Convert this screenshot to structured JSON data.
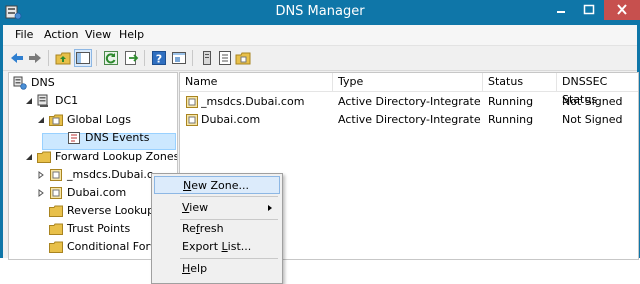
{
  "window": {
    "title": "DNS Manager"
  },
  "menubar": {
    "items": [
      "File",
      "Action",
      "View",
      "Help"
    ]
  },
  "toolbar": {
    "buttons": [
      "back-icon",
      "forward-icon",
      "up-folder-icon",
      "show-hide-tree-icon",
      "refresh-icon",
      "export-icon",
      "help-icon",
      "properties-icon",
      "server-icon",
      "list-icon",
      "zone-icon"
    ]
  },
  "tree": {
    "root": "DNS",
    "server": "DC1",
    "global_logs": "Global Logs",
    "dns_events": "DNS Events",
    "forward_zones": "Forward Lookup Zones",
    "msdcs": "_msdcs.Dubai.c",
    "dubai": "Dubai.com",
    "reverse_zones": "Reverse Lookup Zon",
    "trust_points": "Trust Points",
    "conditional": "Conditional Forwar"
  },
  "list": {
    "columns": [
      "Name",
      "Type",
      "Status",
      "DNSSEC Status"
    ],
    "rows": [
      {
        "name": "_msdcs.Dubai.com",
        "type": "Active Directory-Integrated Pr...",
        "status": "Running",
        "dnssec": "Not Signed"
      },
      {
        "name": "Dubai.com",
        "type": "Active Directory-Integrated Pr...",
        "status": "Running",
        "dnssec": "Not Signed"
      }
    ]
  },
  "context_menu": {
    "new_zone": {
      "prefix": "",
      "key": "N",
      "rest": "ew Zone..."
    },
    "view": {
      "prefix": "",
      "key": "V",
      "rest": "iew"
    },
    "refresh": {
      "prefix": "Re",
      "key": "f",
      "rest": "resh"
    },
    "export": {
      "prefix": "Export ",
      "key": "L",
      "rest": "ist..."
    },
    "help": {
      "prefix": "",
      "key": "H",
      "rest": "elp"
    }
  },
  "colors": {
    "titlebar": "#0f76a8",
    "close_button": "#c7504e",
    "selection": "#cce8ff",
    "menu_highlight": "#dcebfb"
  }
}
